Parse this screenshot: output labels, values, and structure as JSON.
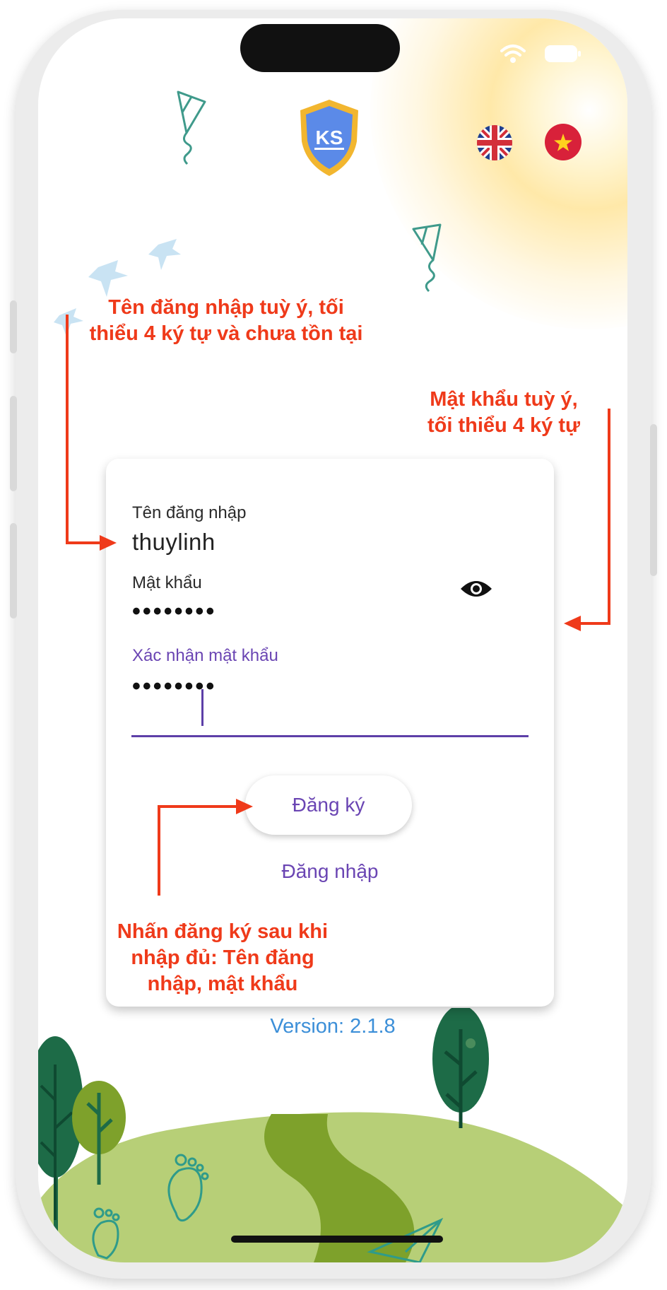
{
  "form": {
    "username_label": "Tên đăng nhập",
    "username_value": "thuylinh",
    "password_label": "Mật khẩu",
    "password_value": "••••••••",
    "confirm_label": "Xác nhận mật khẩu",
    "confirm_value": "••••••••"
  },
  "actions": {
    "register_label": "Đăng ký",
    "login_label": "Đăng nhập"
  },
  "version_text": "Version: 2.1.8",
  "annotations": {
    "username_note": [
      "Tên đăng nhập tuỳ ý, tối",
      "thiểu 4 ký tự và chưa tồn tại"
    ],
    "password_note": [
      "Mật khẩu tuỳ ý,",
      "tối thiểu 4 ký tự"
    ],
    "register_note": [
      "Nhấn đăng ký sau khi",
      "nhập đủ: Tên đăng",
      "nhập, mật khẩu"
    ]
  },
  "logo_text": "KS",
  "languages": [
    "english",
    "vietnamese"
  ],
  "icons": [
    "wifi-icon",
    "battery-icon",
    "eye-icon",
    "uk-flag-icon",
    "vn-flag-icon"
  ],
  "colors": {
    "accent": "#6a45b3",
    "annotation": "#ef3a1a",
    "version": "#3c8fd8",
    "hill_light": "#b7cf77",
    "hill_dark": "#7ea12b",
    "tree_dark": "#1d6b47"
  }
}
